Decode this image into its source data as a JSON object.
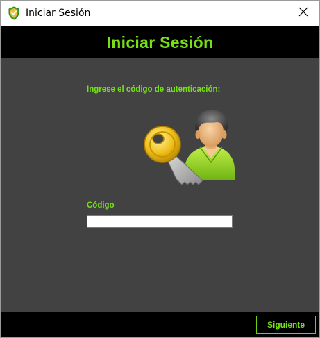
{
  "window": {
    "title": "Iniciar Sesión",
    "icon": "shield-check-icon",
    "close_icon": "close-icon"
  },
  "header": {
    "title": "Iniciar Sesión"
  },
  "form": {
    "instruction": "Ingrese el código de autenticación:",
    "illustration": "user-with-key-icon",
    "code_label": "Código",
    "code_value": "",
    "code_placeholder": ""
  },
  "footer": {
    "next_label": "Siguiente"
  },
  "colors": {
    "accent": "#76e015",
    "header_bg": "#000000",
    "content_bg": "#424242",
    "footer_bg": "#000000"
  }
}
